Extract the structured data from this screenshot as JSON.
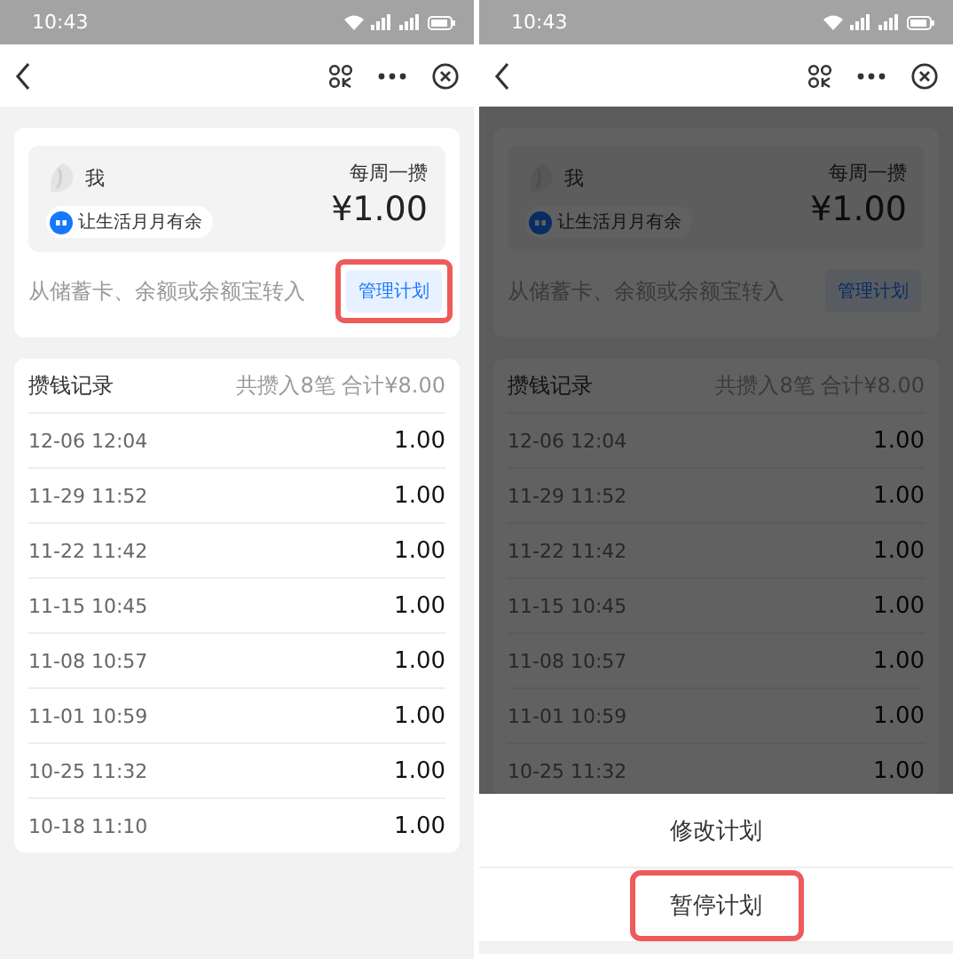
{
  "screens": [
    {
      "status_bar": {
        "time": "10:43"
      },
      "dimmed": false,
      "plan": {
        "owner": "我",
        "frequency": "每周一攒",
        "motto": "让生活月月有余",
        "amount": "¥1.00",
        "source": "从储蓄卡、余额或余额宝转入",
        "manage_button": {
          "label": "管理计划",
          "highlighted": true
        }
      },
      "records": {
        "title": "攒钱记录",
        "summary": "共攒入8笔 合计¥8.00",
        "rows": [
          {
            "time": "12-06 12:04",
            "amount": "1.00"
          },
          {
            "time": "11-29 11:52",
            "amount": "1.00"
          },
          {
            "time": "11-22 11:42",
            "amount": "1.00"
          },
          {
            "time": "11-15 10:45",
            "amount": "1.00"
          },
          {
            "time": "11-08 10:57",
            "amount": "1.00"
          },
          {
            "time": "11-01 10:59",
            "amount": "1.00"
          },
          {
            "time": "10-25 11:32",
            "amount": "1.00"
          },
          {
            "time": "10-18 11:10",
            "amount": "1.00"
          }
        ]
      }
    },
    {
      "status_bar": {
        "time": "10:43"
      },
      "dimmed": true,
      "plan": {
        "owner": "我",
        "frequency": "每周一攒",
        "motto": "让生活月月有余",
        "amount": "¥1.00",
        "source": "从储蓄卡、余额或余额宝转入",
        "manage_button": {
          "label": "管理计划"
        }
      },
      "records": {
        "title": "攒钱记录",
        "summary": "共攒入8笔 合计¥8.00",
        "rows": [
          {
            "time": "12-06 12:04",
            "amount": "1.00"
          },
          {
            "time": "11-29 11:52",
            "amount": "1.00"
          },
          {
            "time": "11-22 11:42",
            "amount": "1.00"
          },
          {
            "time": "11-15 10:45",
            "amount": "1.00"
          },
          {
            "time": "11-08 10:57",
            "amount": "1.00"
          },
          {
            "time": "11-01 10:59",
            "amount": "1.00"
          },
          {
            "time": "10-25 11:32",
            "amount": "1.00"
          }
        ]
      },
      "action_sheet": {
        "items": [
          {
            "label": "修改计划",
            "highlighted": false
          },
          {
            "label": "暂停计划",
            "highlighted": true
          }
        ]
      }
    }
  ]
}
